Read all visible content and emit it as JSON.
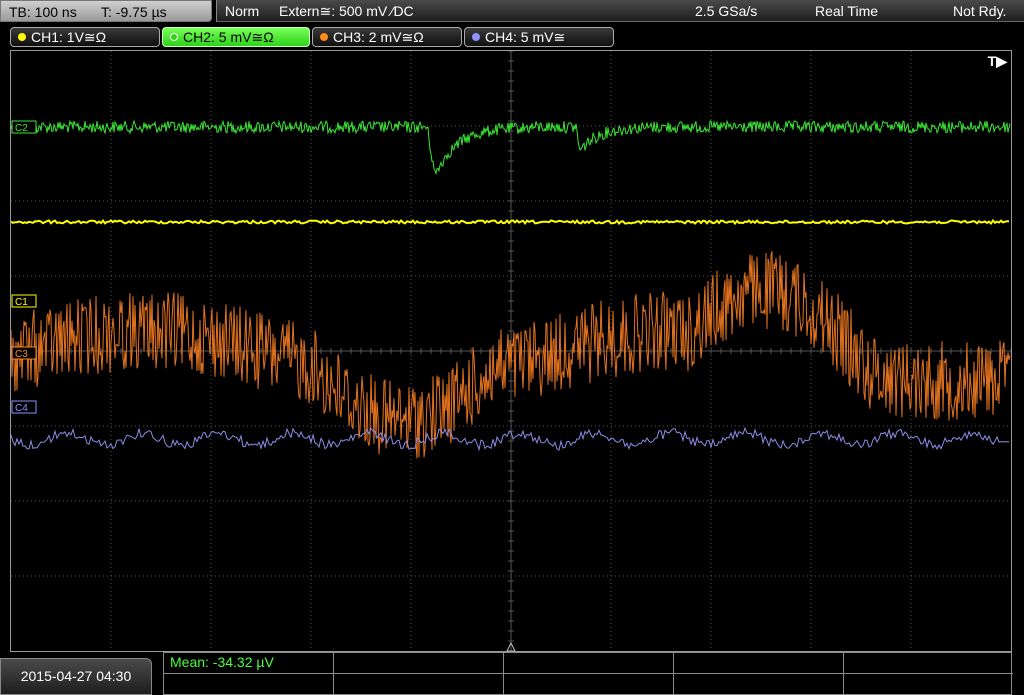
{
  "topbar": {
    "timebase": "TB: 100 ns",
    "trigger_pos": "T: -9.75 µs",
    "mode": "Norm",
    "trigger": "Extern≅: 500 mV ⁄DC",
    "sample_rate": "2.5 GSa/s",
    "acq_mode": "Real Time",
    "trigger_state": "Not Rdy."
  },
  "channels": [
    {
      "label": "CH1: 1V≅Ω",
      "color": "#ffff00",
      "marker": "C1"
    },
    {
      "label": "CH2: 5 mV≅Ω",
      "color": "#39e632",
      "marker": "C2"
    },
    {
      "label": "CH3: 2 mV≅Ω",
      "color": "#ff8a1e",
      "marker": "C3"
    },
    {
      "label": "CH4: 5 mV≅",
      "color": "#9090ff",
      "marker": "C4"
    }
  ],
  "screen": {
    "trigger_marker": "T▶"
  },
  "bottom": {
    "datetime": "2015-04-27 04:30",
    "measurement": "Mean: -34.32 µV"
  },
  "colors": {
    "grid": "#555555",
    "ch2_trace": "#39e632",
    "ch1_trace": "#ffff00",
    "ch3_trace": "#e4731e",
    "ch4_trace": "#8c8ce6"
  }
}
